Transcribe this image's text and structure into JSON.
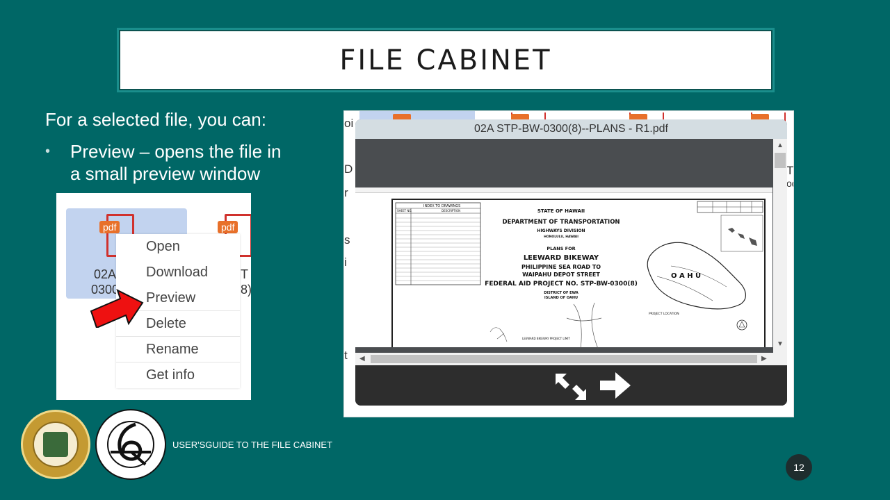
{
  "title": "FILE CABINET",
  "intro": "For a selected file, you can:",
  "bullet": "Preview – opens the file in a small preview window",
  "context_shot": {
    "file1_badge": "pdf",
    "file1_name_line1": "02A S",
    "file1_name_line2": "0300(8",
    "file2_badge": "pdf",
    "file2_name_line1": "T",
    "file2_name_line2": "8)",
    "menu_items": [
      "Open",
      "Download",
      "Preview",
      "Delete",
      "Rename",
      "Get info"
    ]
  },
  "preview_shot": {
    "dialog_title": "02A STP-BW-0300(8)--PLANS - R1.pdf",
    "bg_fragments": [
      "oi",
      "D",
      "r",
      "s",
      "i",
      "t",
      "T",
      "od"
    ],
    "drawing": {
      "state": "STATE OF HAWAII",
      "dept": "DEPARTMENT OF TRANSPORTATION",
      "division": "HIGHWAYS DIVISION",
      "city": "HONOLULU, HAWAII",
      "plans_for": "PLANS FOR",
      "project": "LEEWARD BIKEWAY",
      "route1": "PHILIPPINE SEA ROAD TO",
      "route2": "WAIPAHU DEPOT STREET",
      "fed": "FEDERAL AID PROJECT NO. STP-BW-0300(8)",
      "district": "DISTRICT OF EWA",
      "island": "ISLAND OF OAHU",
      "oahu": "O A H U",
      "index_title": "INDEX TO DRAWINGS",
      "col1": "SHEET NO.",
      "col2": "DESCRIPTION",
      "project_location": "PROJECT LOCATION",
      "bikeway_limit": "LEEWARD BIKEWAY PROJECT LIMIT"
    }
  },
  "footer": "USER'SGUIDE TO THE FILE CABINET",
  "page_number": "12",
  "icons": {
    "expand": "expand-arrows-icon",
    "next": "right-arrow-icon",
    "pointer": "red-arrow-icon"
  },
  "colors": {
    "background": "#006766",
    "title_border": "#1a8e8c",
    "pdf_badge": "#e8702a",
    "pdf_outline": "#d0312d",
    "selection": "#c2d3ef",
    "pointer_arrow": "#ee1111"
  }
}
